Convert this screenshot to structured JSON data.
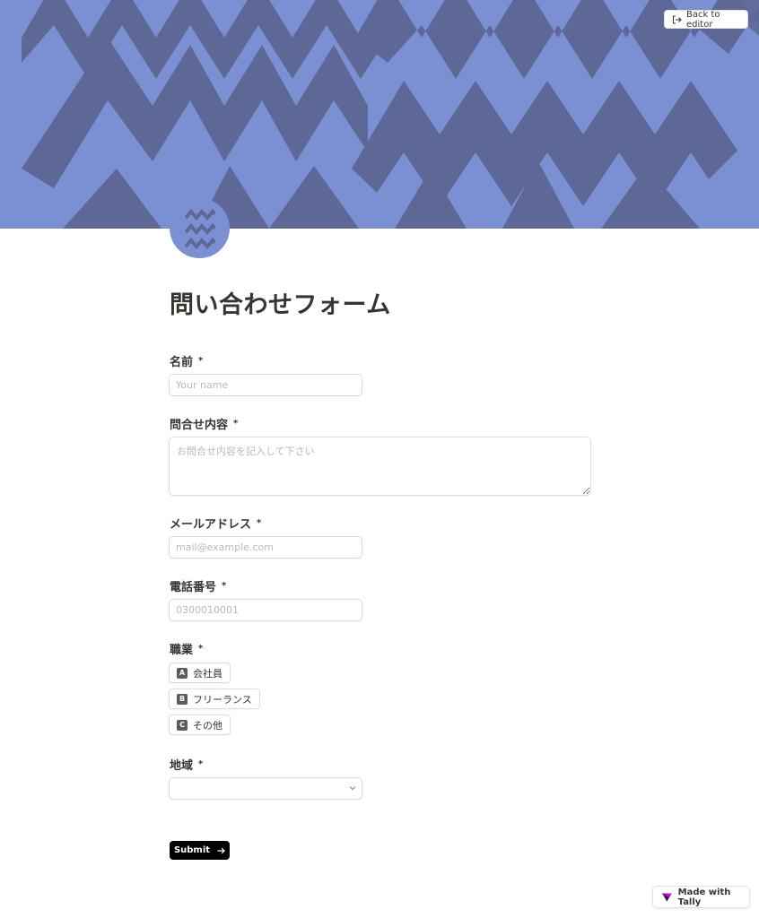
{
  "header": {
    "back_label": "Back to editor"
  },
  "form": {
    "title": "問い合わせフォーム",
    "required_mark": "*",
    "fields": [
      {
        "label": "名前",
        "placeholder": "Your name"
      },
      {
        "label": "問合せ内容",
        "placeholder": "お問合せ内容を記入して下さい"
      },
      {
        "label": "メールアドレス",
        "placeholder": "mail@example.com"
      },
      {
        "label": "電話番号",
        "placeholder": "0300010001"
      },
      {
        "label": "職業",
        "options": [
          {
            "key": "A",
            "label": "会社員"
          },
          {
            "key": "B",
            "label": "フリーランス"
          },
          {
            "key": "C",
            "label": "その他"
          }
        ]
      },
      {
        "label": "地域",
        "selected": ""
      }
    ],
    "submit_label": "Submit"
  },
  "footer": {
    "badge_label": "Made with Tally"
  },
  "icons": {
    "back": "exit-arrow-icon",
    "submit": "arrow-right-icon",
    "select": "chevron-down-icon",
    "tally": "tally-logo-icon",
    "logo": "zigzag-waves-icon"
  },
  "colors": {
    "cover_light": "#7b8fd3",
    "cover_dark": "#5e6896",
    "submit_bg": "#000000",
    "text": "#37352f"
  }
}
